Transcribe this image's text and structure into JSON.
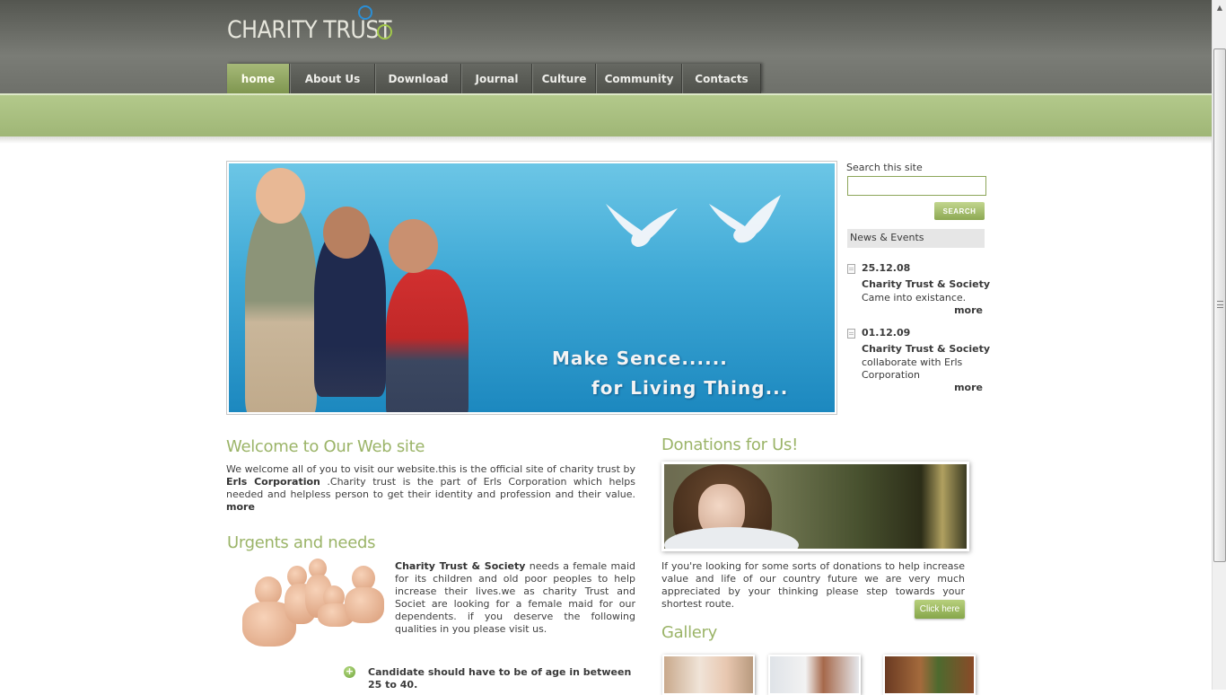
{
  "site": {
    "logo_text": "CHARITY TRUST",
    "nav": [
      {
        "label": "home",
        "active": true
      },
      {
        "label": "About Us",
        "active": false
      },
      {
        "label": "Download",
        "active": false
      },
      {
        "label": "Journal",
        "active": false
      },
      {
        "label": "Culture",
        "active": false
      },
      {
        "label": "Community",
        "active": false
      },
      {
        "label": "Contacts",
        "active": false
      }
    ],
    "accent_color": "#9bb468",
    "header_color": "#5e605a"
  },
  "banner": {
    "line1": "Make Sence......",
    "line2": "for Living Thing..."
  },
  "sidebar": {
    "search_label": "Search this site",
    "search_value": "",
    "search_button": "SEARCH",
    "news_header": "News & Events",
    "news": [
      {
        "date": "25.12.08",
        "title": "Charity Trust & Society",
        "desc": "Came into existance.",
        "more": "more"
      },
      {
        "date": "01.12.09",
        "title": "Charity Trust & Society",
        "desc": "collaborate with Erls Corporation",
        "more": "more"
      }
    ]
  },
  "welcome": {
    "heading": "Welcome to Our Web site",
    "text_before": "We welcome all of you to visit our website.this is the official site of charity trust by ",
    "bold": "Erls Corporation",
    "text_after": " .Charity trust is the part of Erls Corporation which helps needed and helpless person to get their identity and profession and their value. ",
    "more": "more"
  },
  "urgents": {
    "heading": "Urgents and needs",
    "bold": "Charity Trust & Society",
    "text": " needs a female maid for its children and old poor peoples to help increase their lives.we as charity Trust and Societ are looking for a female maid for our dependents. if you deserve the following qualities in you please visit us.",
    "requirement": "Candidate should have to be of age in between 25 to 40."
  },
  "donations": {
    "heading": "Donations for Us!",
    "text": "If you're looking for some sorts of donations to help increase value and life of our country future we are very much appreciated by your thinking please step towards your shortest route.",
    "button": "Click here"
  },
  "gallery": {
    "heading": "Gallery"
  }
}
